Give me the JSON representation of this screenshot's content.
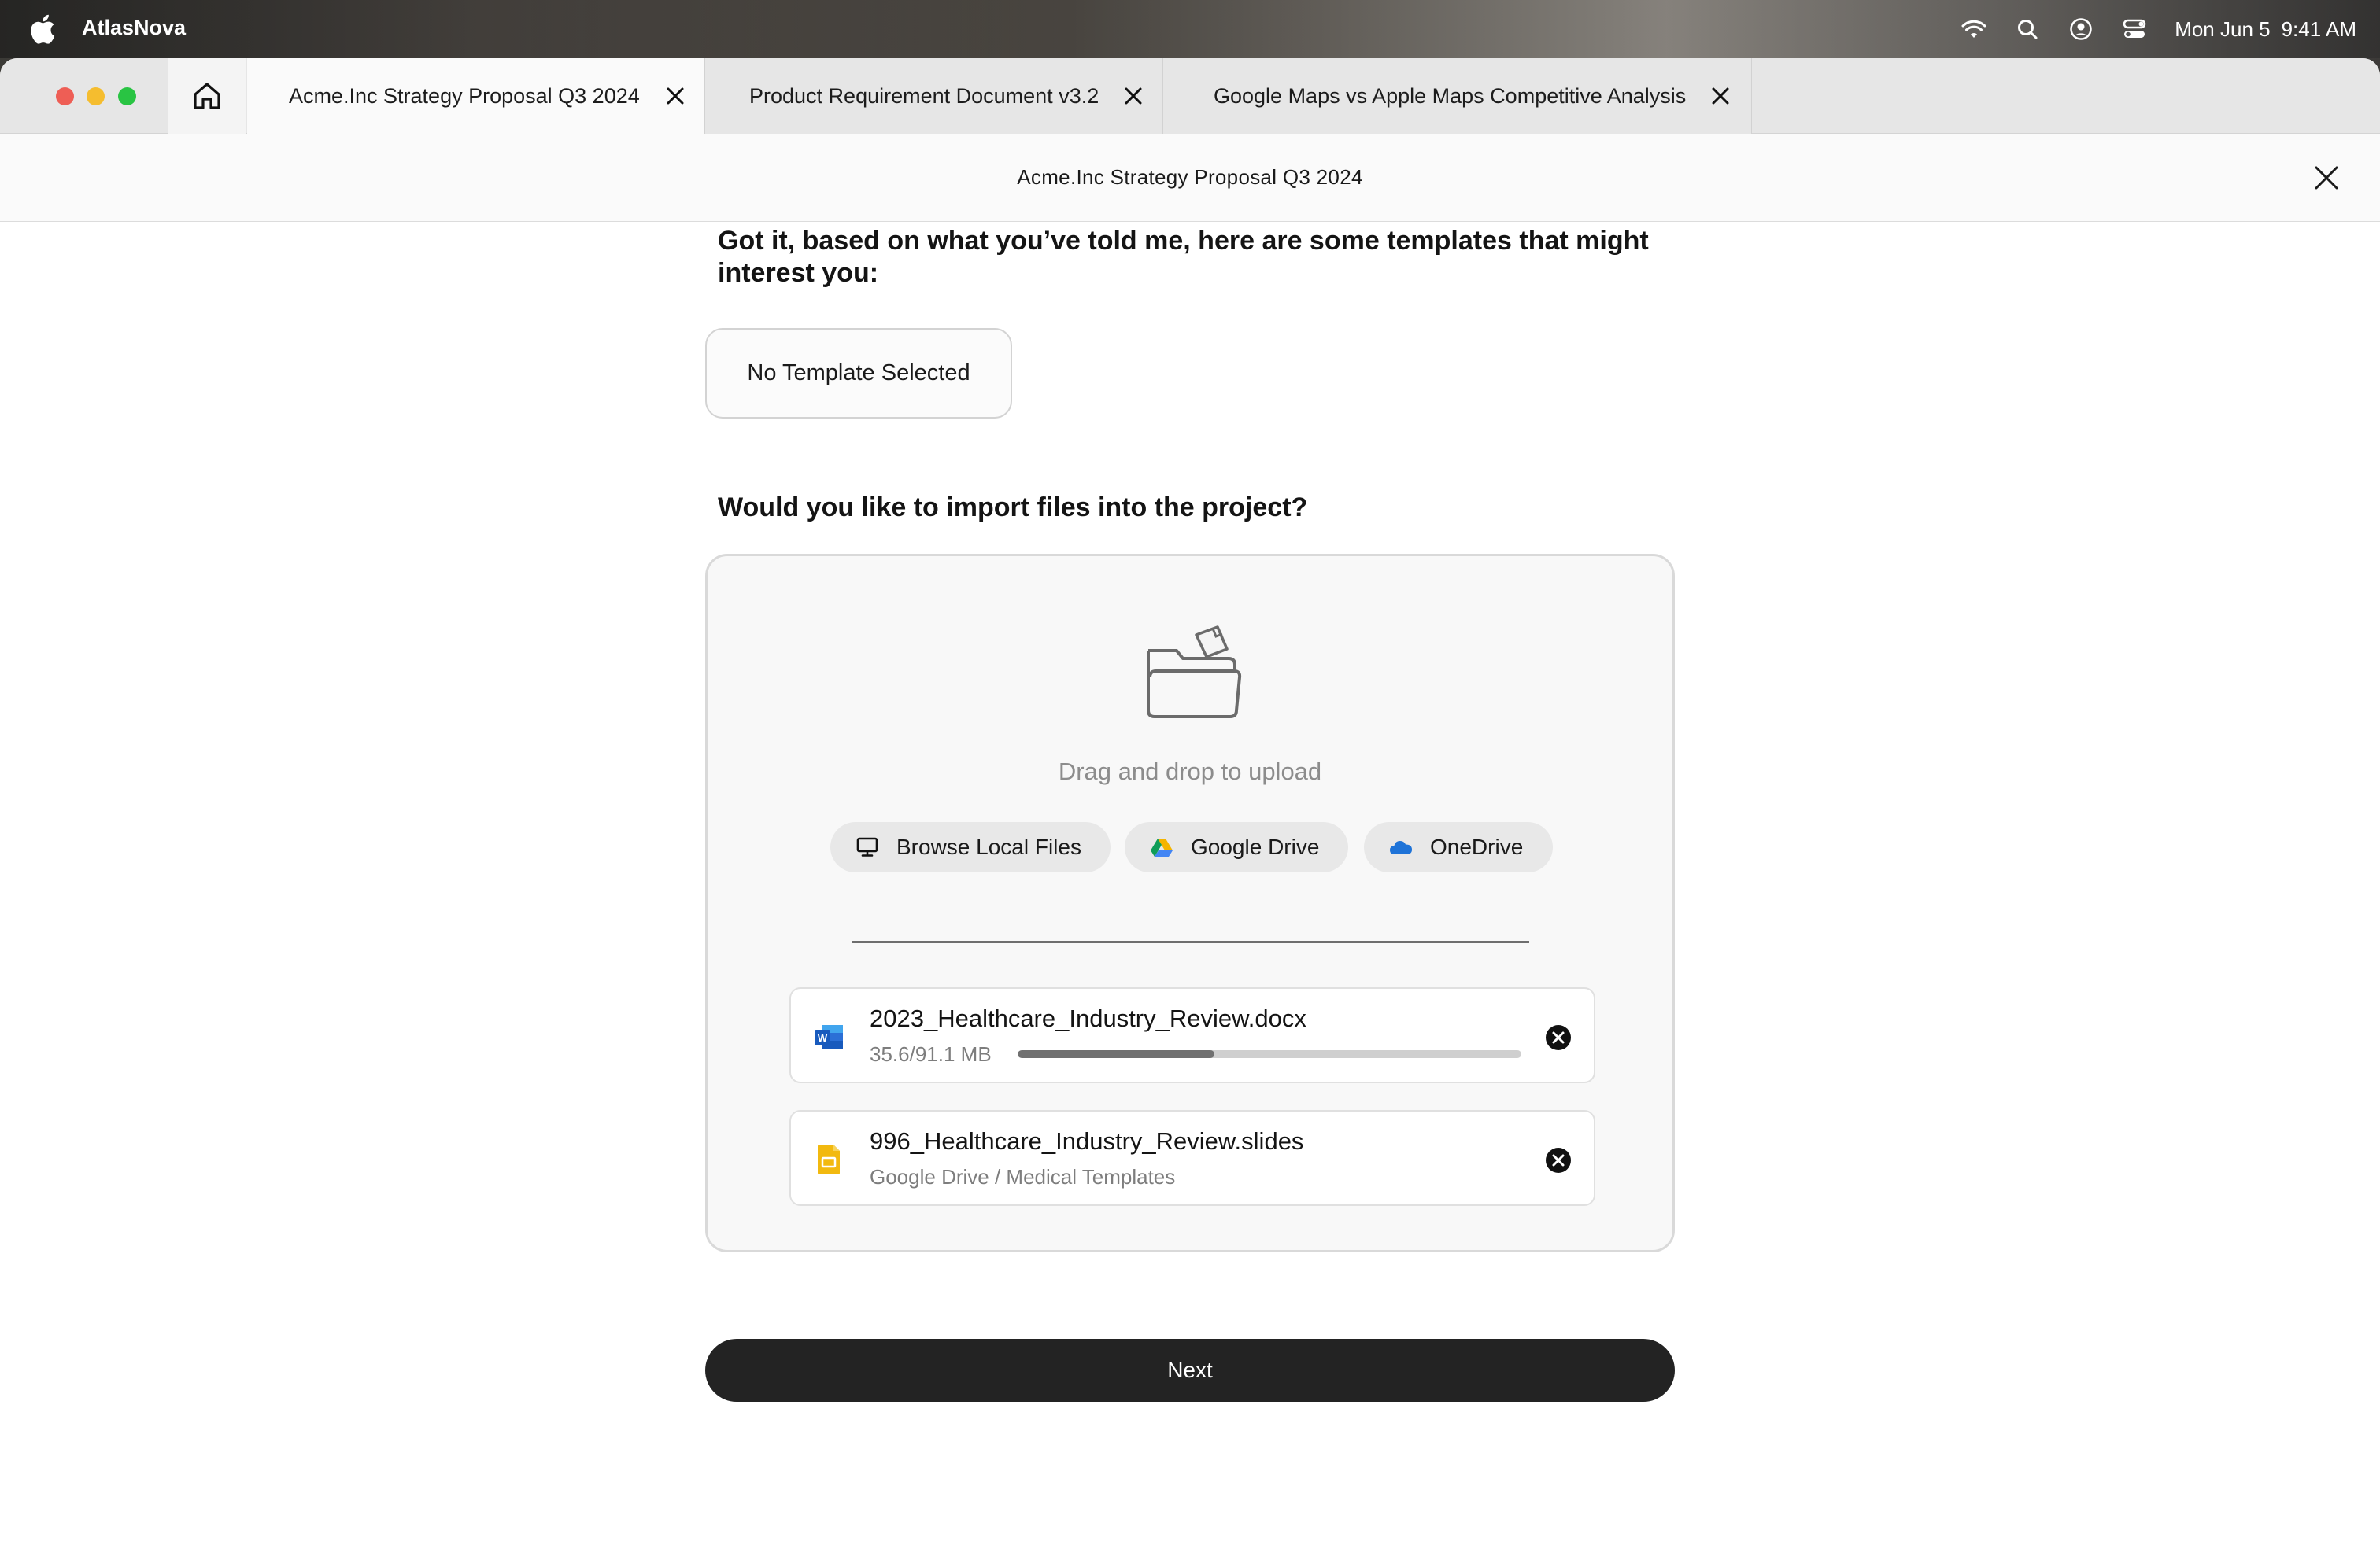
{
  "menubar": {
    "app_name": "AtlasNova",
    "date": "Mon Jun 5",
    "time": "9:41 AM",
    "status_icons": [
      "wifi-icon",
      "search-icon",
      "user-circle-icon",
      "control-center-icon"
    ]
  },
  "tabs": [
    {
      "label": "Acme.Inc Strategy Proposal Q3 2024",
      "active": true
    },
    {
      "label": "Product Requirement Document v3.2",
      "active": false
    },
    {
      "label": "Google Maps vs Apple Maps Competitive Analysis",
      "active": false
    }
  ],
  "titlebar": {
    "title": "Acme.Inc Strategy Proposal Q3 2024"
  },
  "main": {
    "templates_heading": "Got it, based on what you’ve told me, here are some templates that might interest you:",
    "template_button": "No Template Selected",
    "import_heading": "Would you like to import files into the project?",
    "upload": {
      "drag_text": "Drag and drop to upload",
      "sources": [
        {
          "label": "Browse Local Files",
          "icon": "monitor-icon"
        },
        {
          "label": "Google Drive",
          "icon": "google-drive-icon"
        },
        {
          "label": "OneDrive",
          "icon": "onedrive-cloud-icon"
        }
      ],
      "files": [
        {
          "name": "2023_Healthcare_Industry_Review.docx",
          "meta": "35.6/91.1 MB",
          "progress": 0.39,
          "icon": "word-doc-icon"
        },
        {
          "name": "996_Healthcare_Industry_Review.slides",
          "meta": "Google Drive / Medical Templates",
          "icon": "google-slides-icon"
        }
      ]
    },
    "next_label": "Next"
  },
  "colors": {
    "primary_button": "#232323",
    "traffic_red": "#ee5e55",
    "traffic_yellow": "#f5bd2f",
    "traffic_green": "#29c443",
    "word_blue": "#2b6fd6",
    "slides_yellow": "#f2b90f",
    "onedrive_blue": "#1e73d8"
  }
}
